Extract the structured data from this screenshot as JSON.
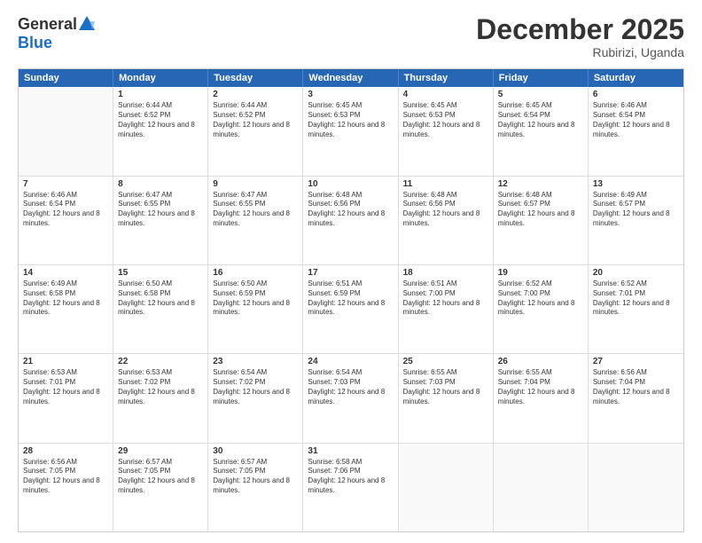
{
  "logo": {
    "general": "General",
    "blue": "Blue"
  },
  "title": "December 2025",
  "subtitle": "Rubirizi, Uganda",
  "header": {
    "days": [
      "Sunday",
      "Monday",
      "Tuesday",
      "Wednesday",
      "Thursday",
      "Friday",
      "Saturday"
    ]
  },
  "weeks": [
    [
      {
        "day": "",
        "empty": true
      },
      {
        "day": "1",
        "sunrise": "Sunrise: 6:44 AM",
        "sunset": "Sunset: 6:52 PM",
        "daylight": "Daylight: 12 hours and 8 minutes."
      },
      {
        "day": "2",
        "sunrise": "Sunrise: 6:44 AM",
        "sunset": "Sunset: 6:52 PM",
        "daylight": "Daylight: 12 hours and 8 minutes."
      },
      {
        "day": "3",
        "sunrise": "Sunrise: 6:45 AM",
        "sunset": "Sunset: 6:53 PM",
        "daylight": "Daylight: 12 hours and 8 minutes."
      },
      {
        "day": "4",
        "sunrise": "Sunrise: 6:45 AM",
        "sunset": "Sunset: 6:53 PM",
        "daylight": "Daylight: 12 hours and 8 minutes."
      },
      {
        "day": "5",
        "sunrise": "Sunrise: 6:45 AM",
        "sunset": "Sunset: 6:54 PM",
        "daylight": "Daylight: 12 hours and 8 minutes."
      },
      {
        "day": "6",
        "sunrise": "Sunrise: 6:46 AM",
        "sunset": "Sunset: 6:54 PM",
        "daylight": "Daylight: 12 hours and 8 minutes."
      }
    ],
    [
      {
        "day": "7",
        "sunrise": "Sunrise: 6:46 AM",
        "sunset": "Sunset: 6:54 PM",
        "daylight": "Daylight: 12 hours and 8 minutes."
      },
      {
        "day": "8",
        "sunrise": "Sunrise: 6:47 AM",
        "sunset": "Sunset: 6:55 PM",
        "daylight": "Daylight: 12 hours and 8 minutes."
      },
      {
        "day": "9",
        "sunrise": "Sunrise: 6:47 AM",
        "sunset": "Sunset: 6:55 PM",
        "daylight": "Daylight: 12 hours and 8 minutes."
      },
      {
        "day": "10",
        "sunrise": "Sunrise: 6:48 AM",
        "sunset": "Sunset: 6:56 PM",
        "daylight": "Daylight: 12 hours and 8 minutes."
      },
      {
        "day": "11",
        "sunrise": "Sunrise: 6:48 AM",
        "sunset": "Sunset: 6:56 PM",
        "daylight": "Daylight: 12 hours and 8 minutes."
      },
      {
        "day": "12",
        "sunrise": "Sunrise: 6:48 AM",
        "sunset": "Sunset: 6:57 PM",
        "daylight": "Daylight: 12 hours and 8 minutes."
      },
      {
        "day": "13",
        "sunrise": "Sunrise: 6:49 AM",
        "sunset": "Sunset: 6:57 PM",
        "daylight": "Daylight: 12 hours and 8 minutes."
      }
    ],
    [
      {
        "day": "14",
        "sunrise": "Sunrise: 6:49 AM",
        "sunset": "Sunset: 6:58 PM",
        "daylight": "Daylight: 12 hours and 8 minutes."
      },
      {
        "day": "15",
        "sunrise": "Sunrise: 6:50 AM",
        "sunset": "Sunset: 6:58 PM",
        "daylight": "Daylight: 12 hours and 8 minutes."
      },
      {
        "day": "16",
        "sunrise": "Sunrise: 6:50 AM",
        "sunset": "Sunset: 6:59 PM",
        "daylight": "Daylight: 12 hours and 8 minutes."
      },
      {
        "day": "17",
        "sunrise": "Sunrise: 6:51 AM",
        "sunset": "Sunset: 6:59 PM",
        "daylight": "Daylight: 12 hours and 8 minutes."
      },
      {
        "day": "18",
        "sunrise": "Sunrise: 6:51 AM",
        "sunset": "Sunset: 7:00 PM",
        "daylight": "Daylight: 12 hours and 8 minutes."
      },
      {
        "day": "19",
        "sunrise": "Sunrise: 6:52 AM",
        "sunset": "Sunset: 7:00 PM",
        "daylight": "Daylight: 12 hours and 8 minutes."
      },
      {
        "day": "20",
        "sunrise": "Sunrise: 6:52 AM",
        "sunset": "Sunset: 7:01 PM",
        "daylight": "Daylight: 12 hours and 8 minutes."
      }
    ],
    [
      {
        "day": "21",
        "sunrise": "Sunrise: 6:53 AM",
        "sunset": "Sunset: 7:01 PM",
        "daylight": "Daylight: 12 hours and 8 minutes."
      },
      {
        "day": "22",
        "sunrise": "Sunrise: 6:53 AM",
        "sunset": "Sunset: 7:02 PM",
        "daylight": "Daylight: 12 hours and 8 minutes."
      },
      {
        "day": "23",
        "sunrise": "Sunrise: 6:54 AM",
        "sunset": "Sunset: 7:02 PM",
        "daylight": "Daylight: 12 hours and 8 minutes."
      },
      {
        "day": "24",
        "sunrise": "Sunrise: 6:54 AM",
        "sunset": "Sunset: 7:03 PM",
        "daylight": "Daylight: 12 hours and 8 minutes."
      },
      {
        "day": "25",
        "sunrise": "Sunrise: 6:55 AM",
        "sunset": "Sunset: 7:03 PM",
        "daylight": "Daylight: 12 hours and 8 minutes."
      },
      {
        "day": "26",
        "sunrise": "Sunrise: 6:55 AM",
        "sunset": "Sunset: 7:04 PM",
        "daylight": "Daylight: 12 hours and 8 minutes."
      },
      {
        "day": "27",
        "sunrise": "Sunrise: 6:56 AM",
        "sunset": "Sunset: 7:04 PM",
        "daylight": "Daylight: 12 hours and 8 minutes."
      }
    ],
    [
      {
        "day": "28",
        "sunrise": "Sunrise: 6:56 AM",
        "sunset": "Sunset: 7:05 PM",
        "daylight": "Daylight: 12 hours and 8 minutes."
      },
      {
        "day": "29",
        "sunrise": "Sunrise: 6:57 AM",
        "sunset": "Sunset: 7:05 PM",
        "daylight": "Daylight: 12 hours and 8 minutes."
      },
      {
        "day": "30",
        "sunrise": "Sunrise: 6:57 AM",
        "sunset": "Sunset: 7:05 PM",
        "daylight": "Daylight: 12 hours and 8 minutes."
      },
      {
        "day": "31",
        "sunrise": "Sunrise: 6:58 AM",
        "sunset": "Sunset: 7:06 PM",
        "daylight": "Daylight: 12 hours and 8 minutes."
      },
      {
        "day": "",
        "empty": true
      },
      {
        "day": "",
        "empty": true
      },
      {
        "day": "",
        "empty": true
      }
    ]
  ]
}
